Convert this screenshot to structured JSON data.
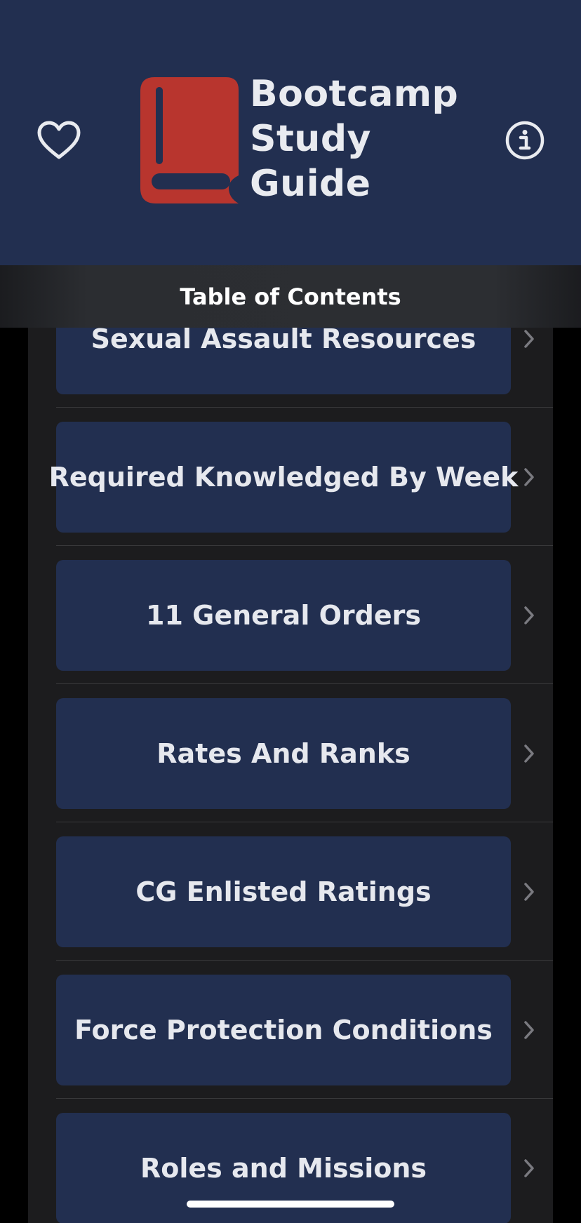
{
  "header": {
    "title": "Bootcamp\nStudy\nGuide",
    "favorite_icon": "heart-icon",
    "info_icon": "info-circle-icon",
    "logo_icon": "book-icon",
    "background": "#222f50",
    "logo_color": "#b8352e"
  },
  "toc": {
    "title": "Table of Contents"
  },
  "items": [
    {
      "label": "Sexual Assault Resources"
    },
    {
      "label": "Required Knowledged By Week"
    },
    {
      "label": "11 General Orders"
    },
    {
      "label": "Rates And Ranks"
    },
    {
      "label": "CG Enlisted Ratings"
    },
    {
      "label": "Force Protection Conditions"
    },
    {
      "label": "Roles and Missions"
    }
  ]
}
